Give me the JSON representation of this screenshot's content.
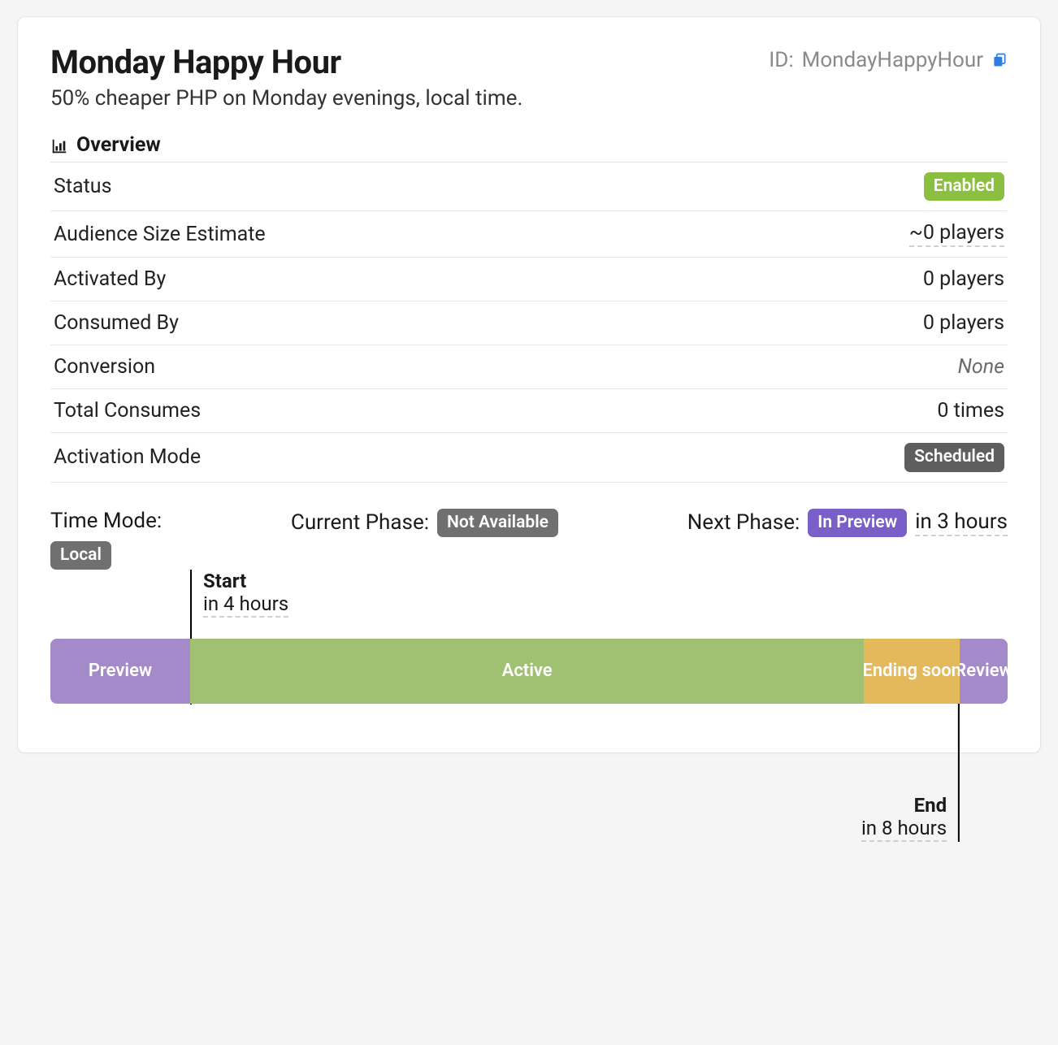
{
  "header": {
    "title": "Monday Happy Hour",
    "id_label": "ID:",
    "id_value": "MondayHappyHour",
    "subtitle": "50% cheaper PHP on Monday evenings, local time."
  },
  "overview": {
    "section_title": "Overview",
    "rows": {
      "status": {
        "label": "Status",
        "badge": "Enabled"
      },
      "audience": {
        "label": "Audience Size Estimate",
        "value": "~0 players"
      },
      "activated_by": {
        "label": "Activated By",
        "value": "0 players"
      },
      "consumed_by": {
        "label": "Consumed By",
        "value": "0 players"
      },
      "conversion": {
        "label": "Conversion",
        "value": "None"
      },
      "total_consumes": {
        "label": "Total Consumes",
        "value": "0 times"
      },
      "activation_mode": {
        "label": "Activation Mode",
        "badge": "Scheduled"
      }
    }
  },
  "phase": {
    "time_mode_label": "Time Mode:",
    "time_mode_badge": "Local",
    "current_label": "Current Phase:",
    "current_badge": "Not Available",
    "next_label": "Next Phase:",
    "next_badge": "In Preview",
    "next_time": "in 3 hours"
  },
  "timeline": {
    "start_label": "Start",
    "start_time": "in 4 hours",
    "end_label": "End",
    "end_time": "in 8 hours",
    "segments": {
      "preview": "Preview",
      "active": "Active",
      "ending": "Ending soon",
      "review": "Review"
    }
  }
}
